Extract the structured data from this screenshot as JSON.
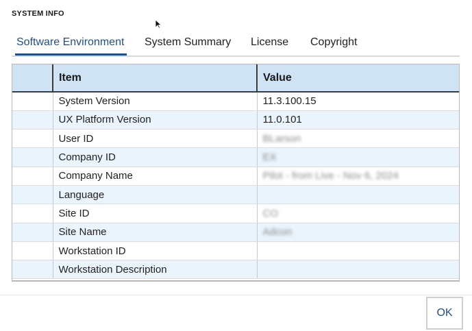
{
  "dialog": {
    "title": "SYSTEM INFO"
  },
  "tabs": [
    {
      "label": "Software Environment",
      "active": true
    },
    {
      "label": "System Summary",
      "active": false
    },
    {
      "label": "License",
      "active": false
    },
    {
      "label": "Copyright",
      "active": false
    }
  ],
  "grid": {
    "columns": {
      "item": "Item",
      "value": "Value"
    },
    "rows": [
      {
        "item": "System Version",
        "value": "11.3.100.15",
        "blurred": false
      },
      {
        "item": "UX Platform Version",
        "value": "11.0.101",
        "blurred": false
      },
      {
        "item": "User ID",
        "value": "BLarson",
        "blurred": true
      },
      {
        "item": "Company ID",
        "value": "EX",
        "blurred": true
      },
      {
        "item": "Company Name",
        "value": "Pilot - from Live - Nov 6, 2024",
        "blurred": true
      },
      {
        "item": "Language",
        "value": "",
        "blurred": false
      },
      {
        "item": "Site ID",
        "value": "CO",
        "blurred": true
      },
      {
        "item": "Site Name",
        "value": "Adcon",
        "blurred": true
      },
      {
        "item": "Workstation ID",
        "value": "",
        "blurred": false
      },
      {
        "item": "Workstation Description",
        "value": "",
        "blurred": false
      }
    ]
  },
  "footer": {
    "ok_label": "OK"
  },
  "colors": {
    "accent": "#1f4e8c",
    "header_bg": "#cfe3f5",
    "alt_row_bg": "#eaf4fd"
  }
}
